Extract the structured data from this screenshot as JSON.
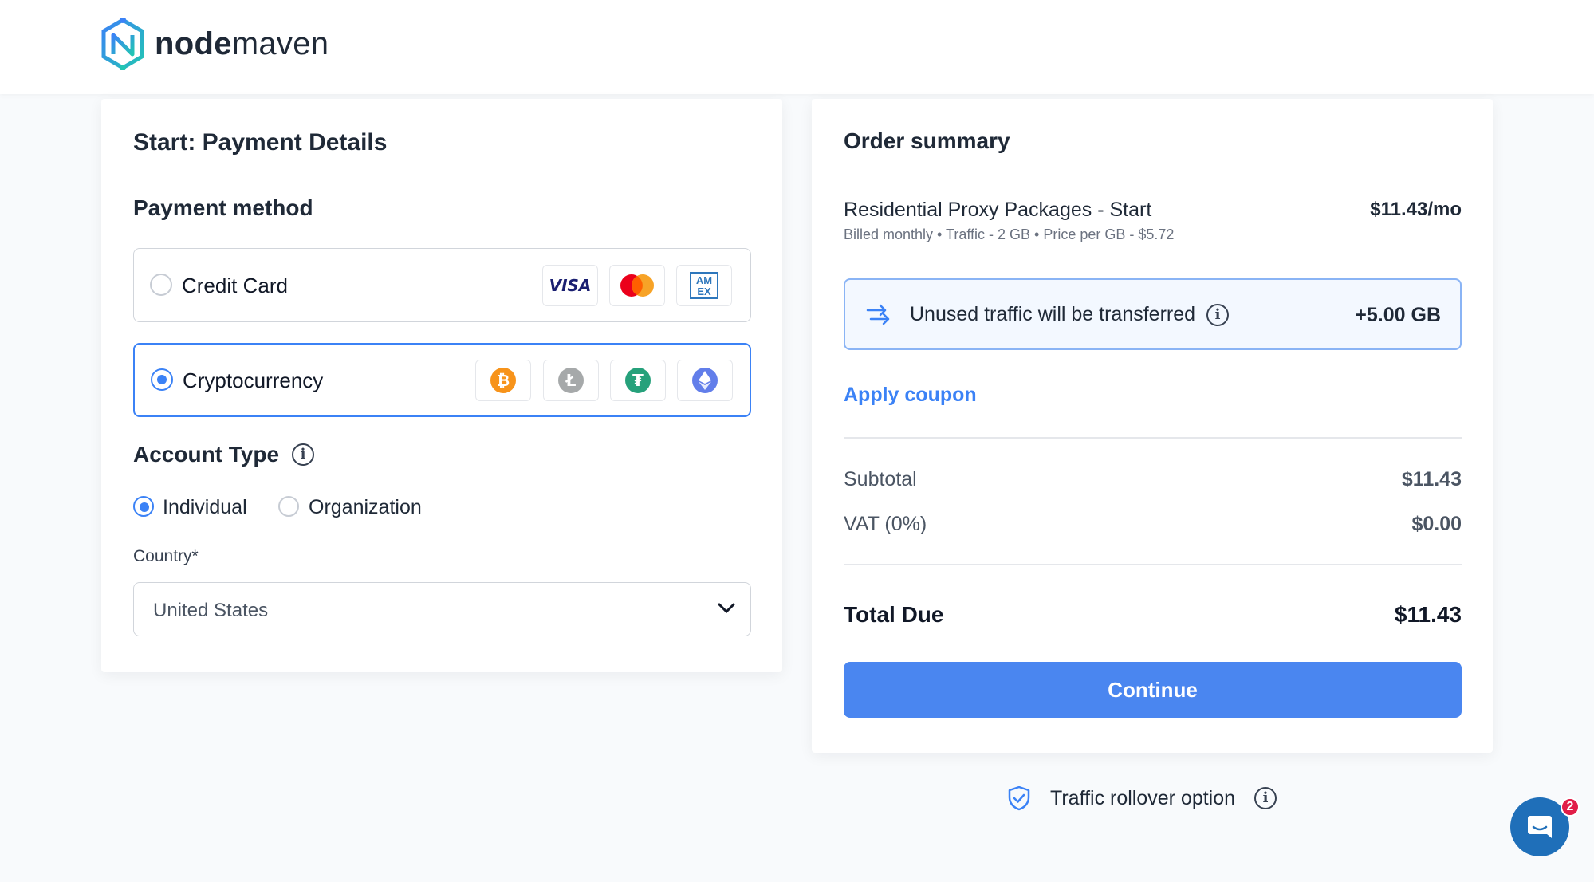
{
  "brand": {
    "name_bold": "node",
    "name_light": "maven",
    "icon": "nodemaven-logo-icon"
  },
  "payment": {
    "title": "Start: Payment Details",
    "method_heading": "Payment method",
    "options": [
      {
        "label": "Credit Card",
        "selected": false,
        "icons": [
          "visa-icon",
          "mastercard-icon",
          "amex-icon"
        ],
        "icon_text": [
          "VISA",
          "AM EX"
        ]
      },
      {
        "label": "Cryptocurrency",
        "selected": true,
        "icons": [
          "bitcoin-icon",
          "litecoin-icon",
          "tether-icon",
          "ethereum-icon"
        ]
      }
    ],
    "account_type": {
      "heading": "Account Type",
      "options": [
        {
          "label": "Individual",
          "selected": true
        },
        {
          "label": "Organization",
          "selected": false
        }
      ]
    },
    "country": {
      "label": "Country*",
      "value": "United States"
    }
  },
  "summary": {
    "title": "Order summary",
    "product": {
      "name": "Residential Proxy Packages - Start",
      "price": "$11.43/mo",
      "details": "Billed monthly • Traffic - 2 GB • Price per GB - $5.72"
    },
    "transfer": {
      "text": "Unused traffic will be transferred",
      "value": "+5.00 GB"
    },
    "coupon_link": "Apply coupon",
    "subtotal": {
      "label": "Subtotal",
      "value": "$11.43"
    },
    "vat": {
      "label": "VAT (0%)",
      "value": "$0.00"
    },
    "total": {
      "label": "Total Due",
      "value": "$11.43"
    },
    "continue_label": "Continue"
  },
  "rollover": {
    "label": "Traffic rollover option"
  },
  "chat": {
    "badge_count": "2"
  },
  "colors": {
    "accent": "#3b82f6",
    "button": "#4a86f0",
    "chat": "#1f6fb9"
  }
}
